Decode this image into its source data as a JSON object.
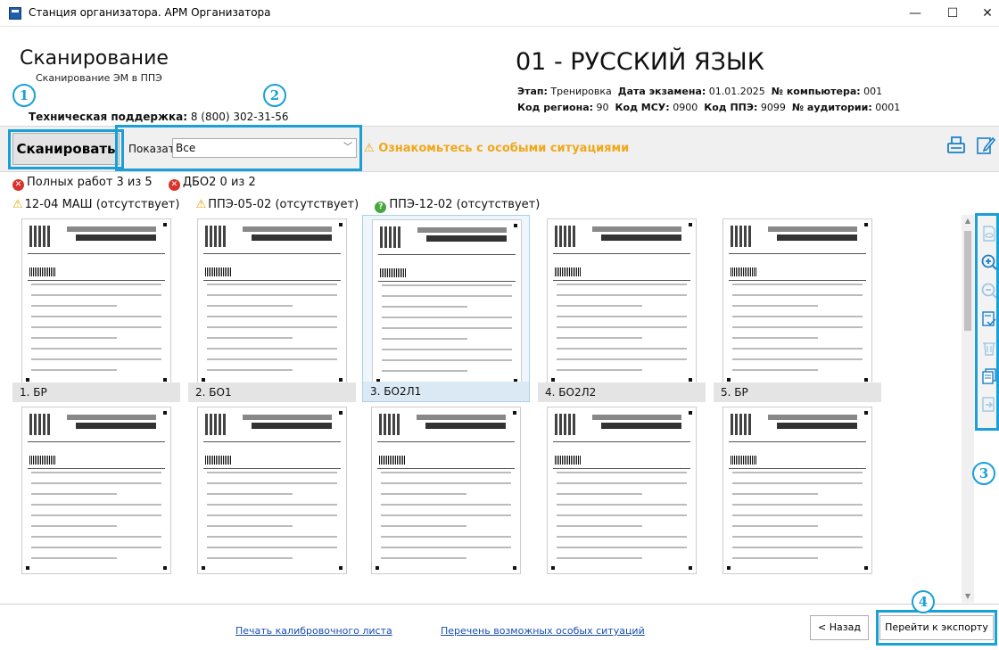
{
  "window": {
    "title": "Станция организатора. АРМ Организатора",
    "minimize": "—",
    "maximize": "☐",
    "close": "✕"
  },
  "header": {
    "title": "Сканирование",
    "subtitle": "Сканирование ЭМ в ППЭ",
    "support_label": "Техническая поддержка:",
    "support_phone": "8 (800) 302-31-56"
  },
  "exam": {
    "title": "01 - РУССКИЙ ЯЗЫК",
    "stage_label": "Этап:",
    "stage_value": "Тренировка",
    "date_label": "Дата экзамена:",
    "date_value": "01.01.2025",
    "pc_label": "№ компьютера:",
    "pc_value": "001",
    "region_label": "Код региона:",
    "region_value": "90",
    "msu_label": "Код МСУ:",
    "msu_value": "0900",
    "ppe_label": "Код ППЭ:",
    "ppe_value": "9099",
    "room_label": "№ аудитории:",
    "room_value": "0001"
  },
  "toolbar": {
    "scan_label": "Сканировать",
    "show_label": "Показать",
    "show_value": "Все",
    "warning_text": "Ознакомьтесь с особыми ситуациями"
  },
  "status": {
    "full_works": "Полных работ 3 из 5",
    "dbo2": "ДБО2 0 из 2",
    "absent_1": "12-04 МАШ (отсутствует)",
    "absent_2": "ППЭ-05-02 (отсутствует)",
    "absent_3": "ППЭ-12-02 (отсутствует)"
  },
  "thumbnails": [
    {
      "label": "1. БР"
    },
    {
      "label": "2. БО1"
    },
    {
      "label": "3. БО2Л1"
    },
    {
      "label": "4. БО2Л2"
    },
    {
      "label": "5. БР"
    },
    {
      "label": ""
    },
    {
      "label": ""
    },
    {
      "label": ""
    },
    {
      "label": ""
    },
    {
      "label": ""
    }
  ],
  "callouts": [
    "1",
    "2",
    "3",
    "4"
  ],
  "footer": {
    "print_calibration": "Печать калибровочного листа",
    "special_situations": "Перечень возможных особых ситуаций",
    "back": "< Назад",
    "export": "Перейти к экспорту"
  },
  "colors": {
    "accent": "#1a9fd6",
    "warning": "#f0a81c",
    "error": "#d9342b",
    "ok": "#46a83c",
    "link": "#1a4fb0"
  }
}
